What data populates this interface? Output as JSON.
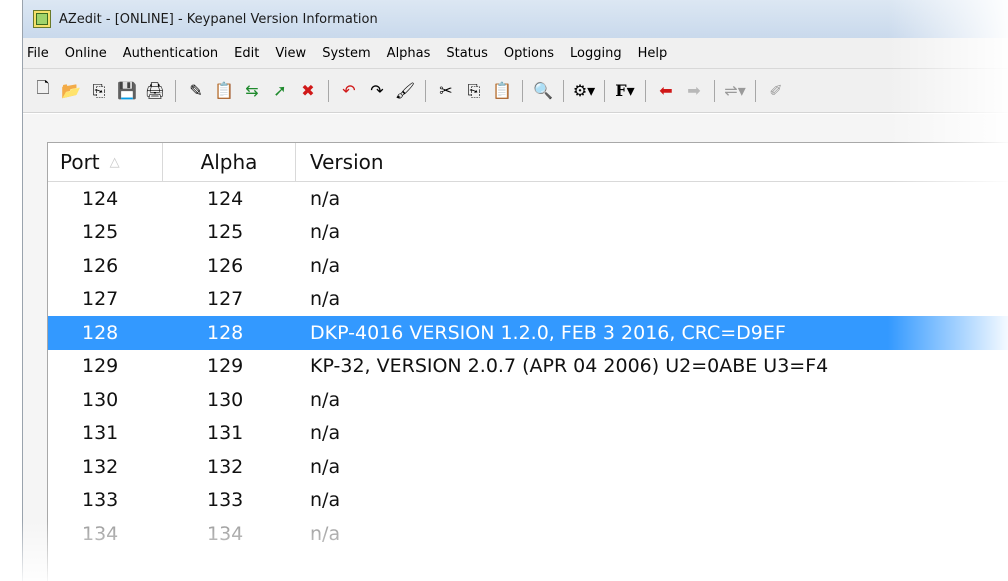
{
  "window": {
    "title": "AZedit - [ONLINE] - Keypanel Version Information"
  },
  "menu": {
    "items": [
      "File",
      "Online",
      "Authentication",
      "Edit",
      "View",
      "System",
      "Alphas",
      "Status",
      "Options",
      "Logging",
      "Help"
    ]
  },
  "toolbar": {
    "icons": [
      "new-icon",
      "open-icon",
      "copy-icon",
      "save-icon",
      "print-icon",
      "edit-icon",
      "paste-icon",
      "transfer-icon",
      "send-icon",
      "cancel-icon",
      "undo-icon",
      "redo-icon",
      "brush-icon",
      "cut-icon",
      "copy2-icon",
      "paste2-icon",
      "search-icon",
      "settings-dropdown-icon",
      "function-dropdown-icon",
      "arrow-left-icon",
      "arrow-right-icon",
      "network-dropdown-icon",
      "tool-icon"
    ]
  },
  "table": {
    "headers": {
      "port": "Port",
      "alpha": "Alpha",
      "version": "Version"
    },
    "rows": [
      {
        "port": "124",
        "alpha": "124",
        "version": "n/a"
      },
      {
        "port": "125",
        "alpha": "125",
        "version": "n/a"
      },
      {
        "port": "126",
        "alpha": "126",
        "version": "n/a"
      },
      {
        "port": "127",
        "alpha": "127",
        "version": "n/a"
      },
      {
        "port": "128",
        "alpha": "128",
        "version": "DKP-4016  VERSION 1.2.0, FEB  3 2016, CRC=D9EF"
      },
      {
        "port": "129",
        "alpha": "129",
        "version": "KP-32, VERSION 2.0.7 (APR 04 2006)  U2=0ABE  U3=F4"
      },
      {
        "port": "130",
        "alpha": "130",
        "version": "n/a"
      },
      {
        "port": "131",
        "alpha": "131",
        "version": "n/a"
      },
      {
        "port": "132",
        "alpha": "132",
        "version": "n/a"
      },
      {
        "port": "133",
        "alpha": "133",
        "version": "n/a"
      },
      {
        "port": "134",
        "alpha": "134",
        "version": "n/a"
      }
    ],
    "selected_port": "128"
  },
  "colors": {
    "selection": "#3399ff",
    "titlebar": "#c9d9ec"
  }
}
